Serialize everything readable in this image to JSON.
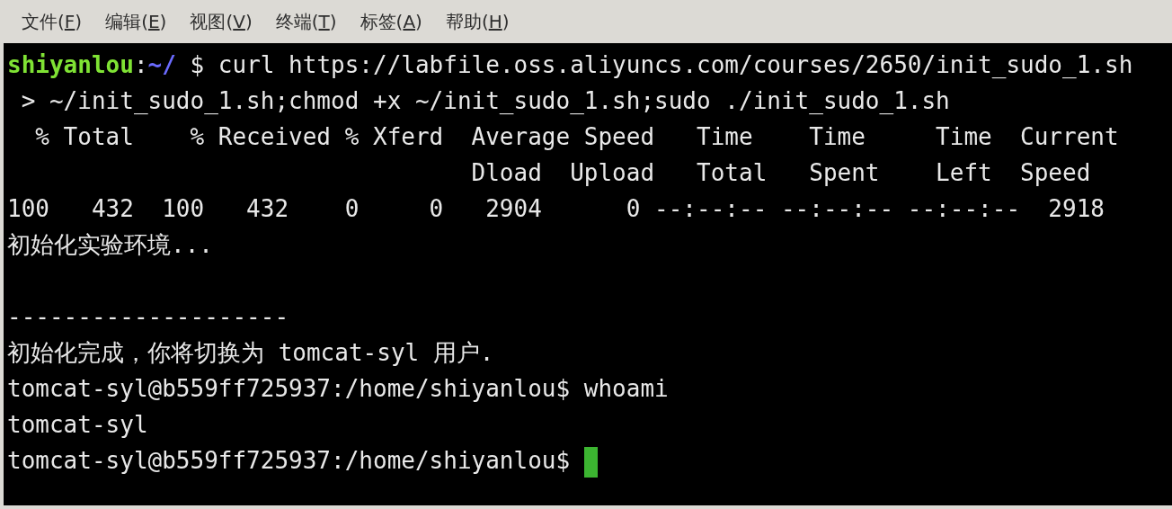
{
  "menu": [
    {
      "before": "文件(",
      "key": "F",
      "after": ")"
    },
    {
      "before": "编辑(",
      "key": "E",
      "after": ")"
    },
    {
      "before": "视图(",
      "key": "V",
      "after": ")"
    },
    {
      "before": "终端(",
      "key": "T",
      "after": ")"
    },
    {
      "before": "标签(",
      "key": "A",
      "after": ")"
    },
    {
      "before": "帮助(",
      "key": "H",
      "after": ")"
    }
  ],
  "terminal": {
    "lines": [
      {
        "kind": "text",
        "segments": [
          {
            "kind": "user",
            "text": "shiyanlou"
          },
          {
            "kind": "plain",
            "text": ":"
          },
          {
            "kind": "path",
            "text": "~/"
          },
          {
            "kind": "plain",
            "text": " $ curl https://labfile.oss.aliyuncs.com/courses/2650/init_sudo_1.sh"
          }
        ]
      },
      {
        "kind": "text",
        "segments": [
          {
            "kind": "plain",
            "text": " > ~/init_sudo_1.sh;chmod +x ~/init_sudo_1.sh;sudo ./init_sudo_1.sh"
          }
        ]
      },
      {
        "kind": "text",
        "segments": [
          {
            "kind": "plain",
            "text": "  % Total    % Received % Xferd  Average Speed   Time    Time     Time  Current"
          }
        ]
      },
      {
        "kind": "text",
        "segments": [
          {
            "kind": "plain",
            "text": "                                 Dload  Upload   Total   Spent    Left  Speed"
          }
        ]
      },
      {
        "kind": "text",
        "segments": [
          {
            "kind": "plain",
            "text": "100   432  100   432    0     0   2904      0 --:--:-- --:--:-- --:--:--  2918"
          }
        ]
      },
      {
        "kind": "text",
        "segments": [
          {
            "kind": "plain",
            "text": "初始化实验环境..."
          }
        ]
      },
      {
        "kind": "blank"
      },
      {
        "kind": "text",
        "segments": [
          {
            "kind": "plain",
            "text": "--------------------"
          }
        ]
      },
      {
        "kind": "text",
        "segments": [
          {
            "kind": "plain",
            "text": "初始化完成，你将切换为 tomcat-syl 用户."
          }
        ]
      },
      {
        "kind": "text",
        "segments": [
          {
            "kind": "plain",
            "text": "tomcat-syl@b559ff725937:/home/shiyanlou$ whoami"
          }
        ]
      },
      {
        "kind": "text",
        "segments": [
          {
            "kind": "plain",
            "text": "tomcat-syl"
          }
        ]
      },
      {
        "kind": "text",
        "cursor": true,
        "segments": [
          {
            "kind": "plain",
            "text": "tomcat-syl@b559ff725937:/home/shiyanlou$ "
          }
        ]
      }
    ]
  }
}
